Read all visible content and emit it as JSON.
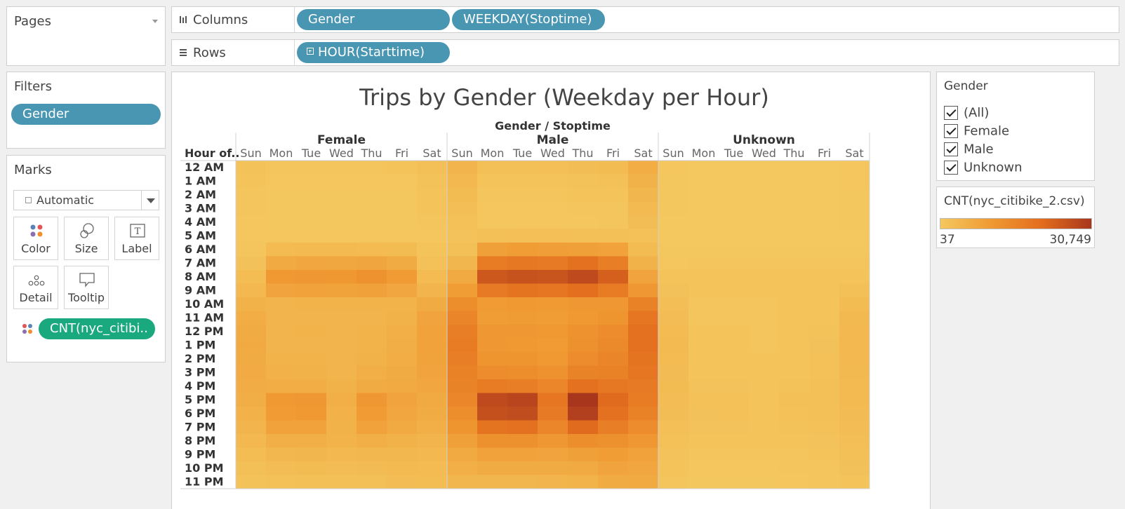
{
  "pages": {
    "title": "Pages"
  },
  "columns_shelf": {
    "label": "Columns",
    "pills": [
      "Gender",
      "WEEKDAY(Stoptime)"
    ]
  },
  "rows_shelf": {
    "label": "Rows",
    "pills": [
      "HOUR(Starttime)"
    ]
  },
  "filters": {
    "title": "Filters",
    "pills": [
      "Gender"
    ]
  },
  "marks": {
    "title": "Marks",
    "mark_type": "Automatic",
    "buttons": [
      "Color",
      "Size",
      "Label",
      "Detail",
      "Tooltip"
    ],
    "color_pill": "CNT(nyc_citibi.."
  },
  "gender_filter_card": {
    "title": "Gender",
    "options": [
      "(All)",
      "Female",
      "Male",
      "Unknown"
    ]
  },
  "legend": {
    "title": "CNT(nyc_citibike_2.csv)",
    "min_label": "37",
    "max_label": "30,749",
    "colors": [
      "#f4c85f",
      "#f09a33",
      "#e36d1e",
      "#a8361d"
    ]
  },
  "chart_data": {
    "type": "heatmap",
    "title": "Trips by Gender (Weekday per Hour)",
    "column_header": "Gender / Stoptime",
    "row_header": "Hour of..",
    "groups": [
      "Female",
      "Male",
      "Unknown"
    ],
    "days": [
      "Sun",
      "Mon",
      "Tue",
      "Wed",
      "Thu",
      "Fri",
      "Sat"
    ],
    "hours": [
      "12 AM",
      "1 AM",
      "2 AM",
      "3 AM",
      "4 AM",
      "5 AM",
      "6 AM",
      "7 AM",
      "8 AM",
      "9 AM",
      "10 AM",
      "11 AM",
      "12 PM",
      "1 PM",
      "2 PM",
      "3 PM",
      "4 PM",
      "5 PM",
      "6 PM",
      "7 PM",
      "8 PM",
      "9 PM",
      "10 PM",
      "11 PM"
    ],
    "scale": {
      "min": 37,
      "max": 30749
    },
    "values": {
      "Female": [
        [
          1400,
          700,
          700,
          700,
          800,
          900,
          1800
        ],
        [
          1000,
          400,
          400,
          400,
          450,
          500,
          1400
        ],
        [
          800,
          300,
          300,
          300,
          300,
          350,
          1100
        ],
        [
          600,
          200,
          200,
          200,
          200,
          250,
          900
        ],
        [
          450,
          200,
          200,
          200,
          200,
          250,
          650
        ],
        [
          400,
          500,
          550,
          550,
          500,
          500,
          450
        ],
        [
          700,
          3000,
          3200,
          3100,
          3000,
          2800,
          900
        ],
        [
          1500,
          7000,
          7500,
          7300,
          7800,
          6500,
          1700
        ],
        [
          2500,
          10500,
          11000,
          10800,
          12000,
          10000,
          3000
        ],
        [
          3500,
          8000,
          8500,
          8300,
          8800,
          7500,
          4500
        ],
        [
          5000,
          4500,
          4700,
          4600,
          4800,
          4700,
          6500
        ],
        [
          6000,
          4200,
          4300,
          4200,
          4500,
          5000,
          8000
        ],
        [
          6500,
          4500,
          4600,
          4400,
          4800,
          5500,
          8500
        ],
        [
          6800,
          4500,
          4500,
          4300,
          4800,
          5800,
          8600
        ],
        [
          6600,
          4700,
          4700,
          4300,
          5000,
          6000,
          8300
        ],
        [
          6400,
          5200,
          5000,
          4500,
          5500,
          6500,
          8000
        ],
        [
          6200,
          6000,
          6000,
          5000,
          6500,
          7000,
          7500
        ],
        [
          5800,
          10500,
          11000,
          5500,
          11000,
          8000,
          7000
        ],
        [
          5200,
          10000,
          10500,
          5200,
          10000,
          7500,
          6500
        ],
        [
          4500,
          8500,
          8500,
          5000,
          8500,
          7000,
          5500
        ],
        [
          3500,
          5500,
          5600,
          4800,
          5600,
          5000,
          4500
        ],
        [
          2500,
          3800,
          4000,
          3500,
          3800,
          3800,
          3500
        ],
        [
          2000,
          2700,
          2800,
          2700,
          2900,
          3100,
          3000
        ],
        [
          1400,
          1700,
          1800,
          1800,
          2000,
          2600,
          2500
        ]
      ],
      "Male": [
        [
          4500,
          2000,
          2000,
          2100,
          2400,
          2800,
          6000
        ],
        [
          3500,
          1200,
          1200,
          1200,
          1400,
          1700,
          5000
        ],
        [
          2800,
          800,
          800,
          800,
          900,
          1100,
          4000
        ],
        [
          2200,
          500,
          500,
          500,
          600,
          700,
          3200
        ],
        [
          1600,
          500,
          500,
          500,
          500,
          600,
          2400
        ],
        [
          1300,
          2000,
          2100,
          2100,
          2000,
          1900,
          1600
        ],
        [
          2000,
          9000,
          9500,
          9300,
          9000,
          8500,
          2800
        ],
        [
          4000,
          17000,
          18000,
          17500,
          19500,
          16500,
          5000
        ],
        [
          7000,
          24500,
          25500,
          25000,
          27000,
          23000,
          8000
        ],
        [
          9500,
          17500,
          19000,
          18500,
          20000,
          17000,
          11000
        ],
        [
          13000,
          10000,
          10500,
          10300,
          11000,
          11000,
          16000
        ],
        [
          15000,
          9500,
          9800,
          9500,
          10500,
          11500,
          18500
        ],
        [
          16500,
          11000,
          11000,
          10500,
          12000,
          13500,
          19500
        ],
        [
          17000,
          11000,
          10500,
          10000,
          12500,
          14000,
          19500
        ],
        [
          16500,
          11500,
          11500,
          10500,
          13500,
          15000,
          19000
        ],
        [
          16000,
          13500,
          13000,
          12000,
          15500,
          16000,
          18500
        ],
        [
          15500,
          17000,
          16500,
          14500,
          19500,
          18000,
          17500
        ],
        [
          14500,
          27000,
          28000,
          18500,
          30749,
          21000,
          17000
        ],
        [
          13000,
          26000,
          26500,
          17500,
          29000,
          19500,
          16000
        ],
        [
          11500,
          19000,
          19500,
          14500,
          21000,
          16500,
          13500
        ],
        [
          9000,
          12500,
          12500,
          11000,
          13000,
          12500,
          11000
        ],
        [
          7000,
          8500,
          8500,
          8000,
          9000,
          9500,
          8500
        ],
        [
          5500,
          6500,
          6500,
          6500,
          7000,
          8000,
          7500
        ],
        [
          4000,
          4000,
          4000,
          4200,
          4800,
          6500,
          7000
        ]
      ],
      "Unknown": [
        [
          400,
          100,
          100,
          100,
          120,
          150,
          500
        ],
        [
          300,
          80,
          80,
          80,
          90,
          100,
          400
        ],
        [
          250,
          60,
          60,
          60,
          60,
          80,
          330
        ],
        [
          200,
          50,
          50,
          50,
          50,
          60,
          270
        ],
        [
          150,
          40,
          40,
          40,
          40,
          50,
          200
        ],
        [
          120,
          80,
          80,
          80,
          80,
          80,
          150
        ],
        [
          200,
          300,
          300,
          300,
          300,
          300,
          250
        ],
        [
          500,
          700,
          700,
          700,
          750,
          700,
          600
        ],
        [
          900,
          1100,
          1100,
          1100,
          1200,
          1100,
          1100
        ],
        [
          1500,
          1000,
          1000,
          1000,
          1100,
          1100,
          1900
        ],
        [
          2200,
          800,
          800,
          800,
          900,
          1100,
          2800
        ],
        [
          2700,
          800,
          800,
          800,
          900,
          1200,
          3300
        ],
        [
          3000,
          900,
          900,
          800,
          1000,
          1400,
          3500
        ],
        [
          3100,
          900,
          900,
          800,
          1000,
          1500,
          3600
        ],
        [
          3000,
          1000,
          1000,
          900,
          1100,
          1600,
          3500
        ],
        [
          2900,
          1100,
          1100,
          900,
          1200,
          1700,
          3400
        ],
        [
          2800,
          1300,
          1300,
          1000,
          1400,
          1800,
          3200
        ],
        [
          2600,
          1600,
          1700,
          1100,
          1800,
          2000,
          3100
        ],
        [
          2400,
          1500,
          1600,
          1100,
          1700,
          1900,
          2900
        ],
        [
          2100,
          1300,
          1300,
          1000,
          1400,
          1700,
          2600
        ],
        [
          1700,
          1000,
          1000,
          900,
          1100,
          1300,
          2200
        ],
        [
          1300,
          700,
          700,
          700,
          800,
          1000,
          1800
        ],
        [
          1000,
          500,
          500,
          500,
          600,
          800,
          1500
        ],
        [
          700,
          300,
          300,
          300,
          400,
          600,
          1200
        ]
      ]
    }
  }
}
